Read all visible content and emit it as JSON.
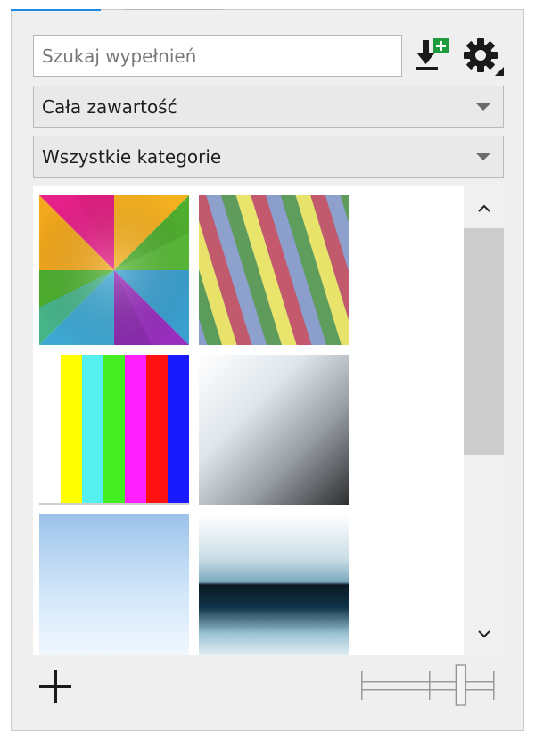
{
  "search": {
    "placeholder": "Szukaj wypełnień",
    "value": ""
  },
  "toolbar": {
    "download_icon": "download-add-icon",
    "settings_icon": "gear-icon"
  },
  "filters": {
    "content": {
      "selected": "Cała zawartość"
    },
    "category": {
      "selected": "Wszystkie kategorie"
    }
  },
  "gallery": {
    "tiles": [
      {
        "kind": "radial-burst"
      },
      {
        "kind": "diagonal-stripes"
      },
      {
        "kind": "color-bars"
      },
      {
        "kind": "diagonal-gradient-white-gray"
      },
      {
        "kind": "sky-blue-gradient"
      },
      {
        "kind": "horizon-blue-band"
      }
    ]
  },
  "footer": {
    "add_icon": "plus-icon",
    "slider_level": 0.75
  },
  "colors": {
    "accent": "#1e88e5",
    "badge_green": "#1e9b3c",
    "panel_bg": "#efefef"
  }
}
